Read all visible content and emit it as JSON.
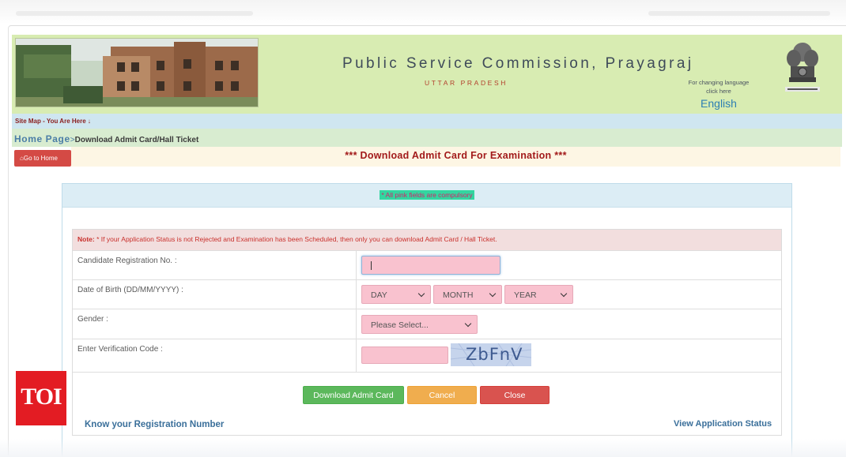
{
  "header": {
    "title": "Public Service Commission, Prayagraj",
    "subtitle": "UTTAR PRADESH",
    "lang_note_line1": "For changing language",
    "lang_note_line2": "click here",
    "lang_link": "English"
  },
  "sitemap": "Site Map - You Are Here ↓",
  "breadcrumb": {
    "home": "Home Page",
    "separator": ">",
    "current": "Download Admit Card/Hall Ticket"
  },
  "go_home": "Go to Home",
  "page_title": "*** Download Admit Card For Examination ***",
  "compulsory_note": "* All pink fields are compulsory",
  "note": {
    "label": "Note:",
    "text": " * If your Application Status is not Rejected and Examination has been Scheduled, then only you can download Admit Card / Hall Ticket."
  },
  "form": {
    "registration_label": "Candidate Registration No. :",
    "registration_value": "",
    "dob_label": "Date of Birth (DD/MM/YYYY) :",
    "day": "DAY",
    "month": "MONTH",
    "year": "YEAR",
    "gender_label": "Gender :",
    "gender_value": "Please Select...",
    "captcha_label": "Enter Verification Code :",
    "captcha_value": "",
    "captcha_text": "ZbFnV"
  },
  "buttons": {
    "download": "Download Admit Card",
    "cancel": "Cancel",
    "close": "Close"
  },
  "links": {
    "know_registration": "Know your Registration Number",
    "view_status": "View Application Status"
  },
  "watermark": "TOI",
  "colors": {
    "header_bg": "#d8ecb2",
    "pink_field": "#f9c2cf",
    "success": "#5cb85c",
    "warning": "#f0ad4e",
    "danger": "#d9534f"
  }
}
